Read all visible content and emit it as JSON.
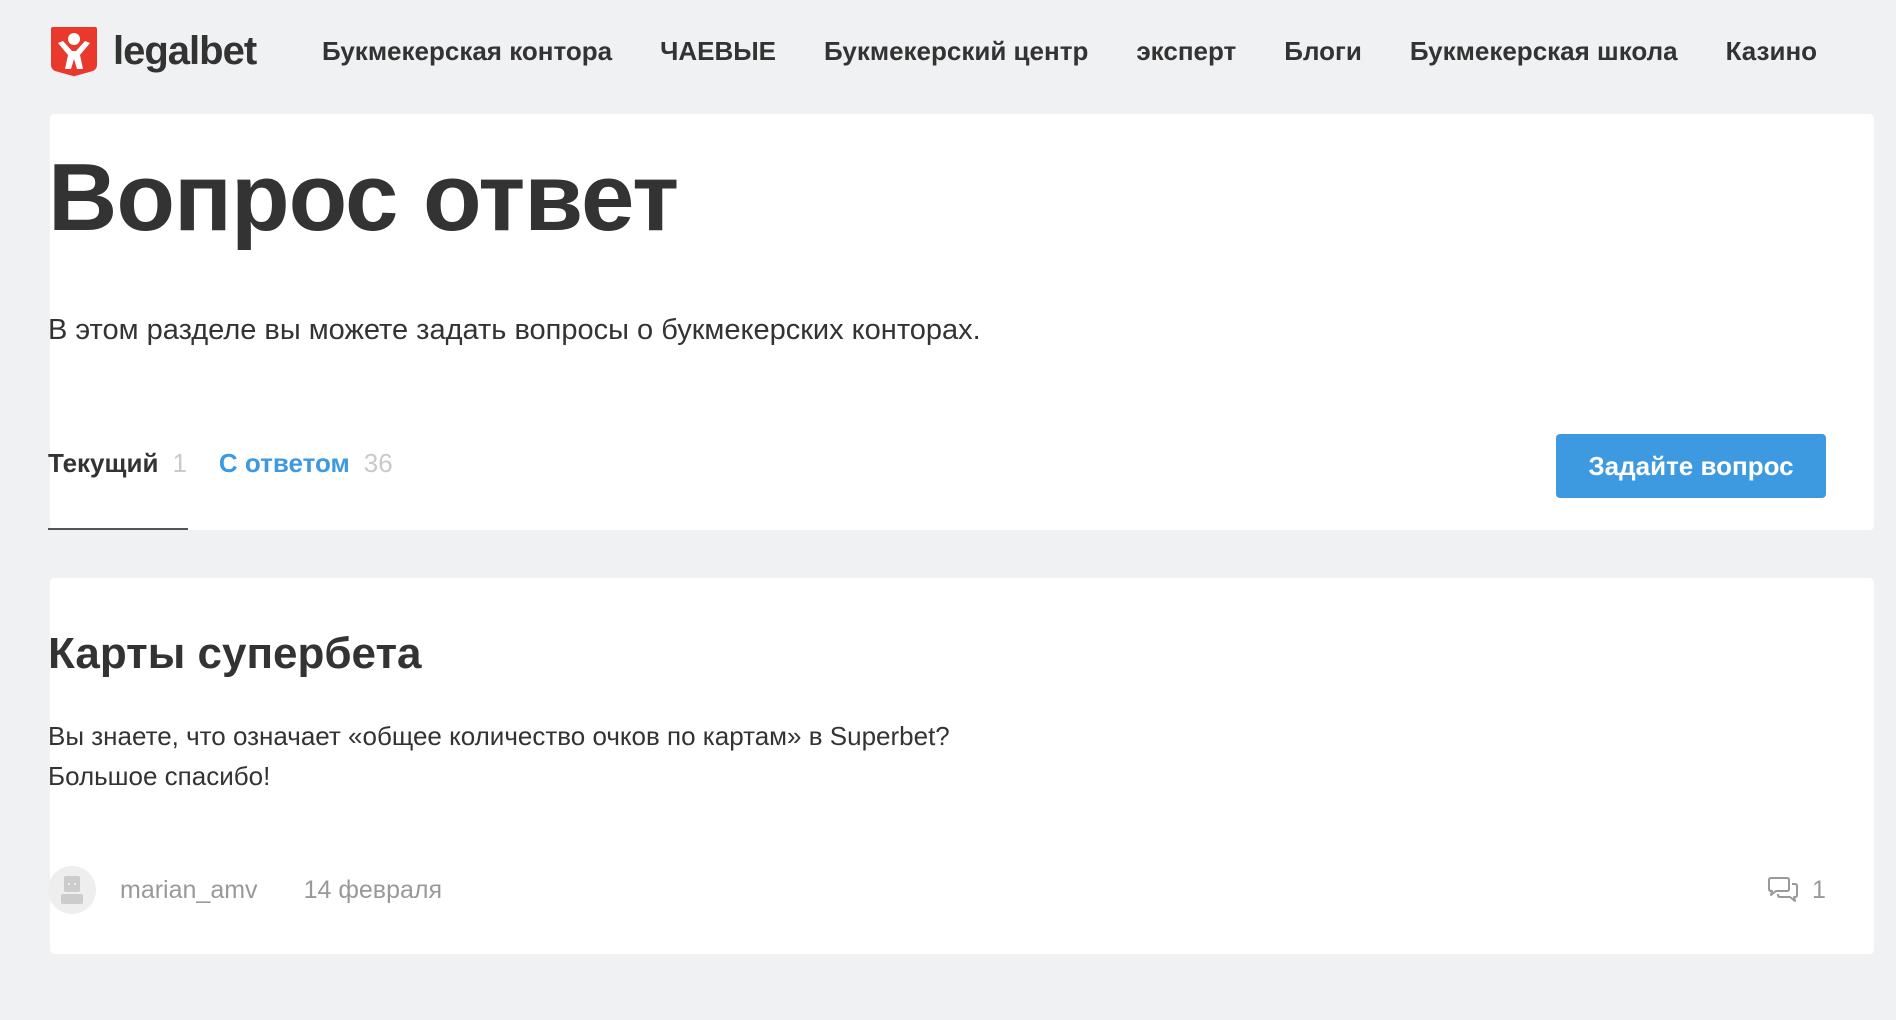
{
  "header": {
    "logo_text": "legalbet",
    "brand_color": "#e8392c",
    "nav": [
      {
        "label": "Букмекерская контора"
      },
      {
        "label": "ЧАЕВЫЕ"
      },
      {
        "label": "Букмекерский центр"
      },
      {
        "label": "эксперт"
      },
      {
        "label": "Блоги"
      },
      {
        "label": "Букмекерская школа"
      },
      {
        "label": "Казино"
      }
    ]
  },
  "intro": {
    "title": "Вопрос ответ",
    "description": "В этом разделе вы можете задать вопросы о букмекерских конторах.",
    "tabs": [
      {
        "label": "Текущий",
        "count": "1",
        "active": true
      },
      {
        "label": "С ответом",
        "count": "36",
        "active": false
      }
    ],
    "ask_button": "Задайте вопрос",
    "accent_color": "#3d9ae0"
  },
  "question": {
    "title": "Карты супербета",
    "body_lines": [
      "Вы знаете, что означает «общее количество очков по картам» в Superbet?",
      "Большое спасибо!"
    ],
    "author": "marian_amv",
    "date": "14 февраля",
    "comment_count": "1",
    "avatar_icon": "user-avatar-icon",
    "comment_icon": "comments-icon"
  }
}
